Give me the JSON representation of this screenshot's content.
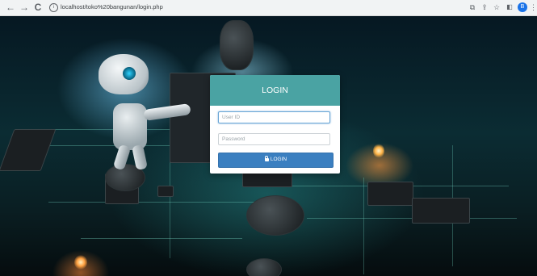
{
  "browser": {
    "url": "localhost/toko%20bangunan/login.php",
    "icons": [
      "back-arrow-icon",
      "forward-arrow-icon",
      "reload-icon",
      "site-info-icon",
      "translate-icon",
      "share-icon",
      "bookmark-star-icon",
      "side-panel-icon",
      "profile-avatar-icon",
      "menu-kebab-icon"
    ],
    "avatar_initial": "B"
  },
  "login": {
    "title": "LOGIN",
    "user_id_placeholder": "User ID",
    "password_placeholder": "Password",
    "button_label": "LOGIN"
  },
  "colors": {
    "header": "#4aa3a3",
    "button": "#3b7fc0"
  }
}
